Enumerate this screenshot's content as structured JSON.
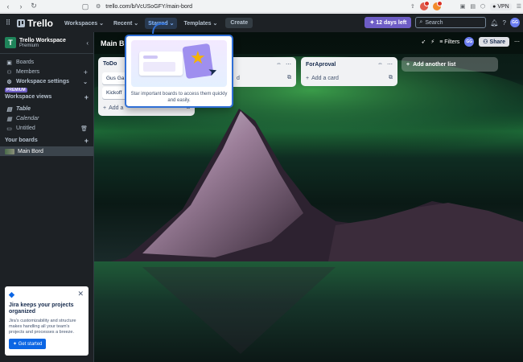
{
  "browser": {
    "url": "trello.com/b/VcUSoGFY/main-bord",
    "vpn_label": "VPN"
  },
  "header": {
    "logo": "Trello",
    "menu": [
      "Workspaces",
      "Recent",
      "Starred",
      "Templates"
    ],
    "create": "Create",
    "trial": "12 days left",
    "search_placeholder": "Search",
    "avatar": "GG"
  },
  "sidebar": {
    "workspace_name": "Trello Workspace",
    "workspace_plan": "Premium",
    "workspace_initial": "T",
    "items": [
      {
        "label": "Boards"
      },
      {
        "label": "Members"
      },
      {
        "label": "Workspace settings"
      }
    ],
    "premium_tag": "PREMIUM",
    "views_header": "Workspace views",
    "views": [
      {
        "label": "Table"
      },
      {
        "label": "Calendar"
      },
      {
        "label": "Untitled"
      }
    ],
    "boards_header": "Your boards",
    "boards": [
      {
        "label": "Main Bord"
      }
    ],
    "jira": {
      "title": "Jira keeps your projects organized",
      "desc": "Jira's customizability and structure makes handling all your team's projects and processes a breeze.",
      "button": "Get started"
    }
  },
  "board": {
    "title": "Main B",
    "filters": "Filters",
    "avatar": "GG",
    "share": "Share",
    "lists": [
      {
        "title": "ToDo",
        "cards": [
          "Gus Ga",
          "Kickoff"
        ],
        "add": "Add a"
      },
      {
        "title": "",
        "cards": [],
        "add": "d"
      },
      {
        "title": "ForAproval",
        "cards": [],
        "add": "Add a card"
      }
    ],
    "add_list": "Add another list"
  },
  "starred_popup": {
    "text": "Star important boards to access them quickly and easily."
  }
}
